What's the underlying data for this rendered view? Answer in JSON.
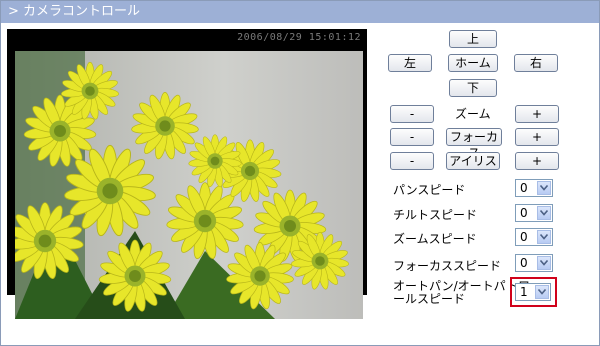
{
  "header": {
    "title": "> カメラコントロール"
  },
  "camera": {
    "timestamp": "2006/08/29 15:01:12"
  },
  "controls": {
    "up": "上",
    "left": "左",
    "home": "ホーム",
    "right": "右",
    "down": "下",
    "zoom_minus": "-",
    "zoom_label": "ズーム",
    "zoom_plus": "+",
    "focus_minus": "-",
    "focus": "フォーカス",
    "focus_plus": "+",
    "iris_minus": "-",
    "iris": "アイリス",
    "iris_plus": "+"
  },
  "speeds": [
    {
      "label": "パンスピード",
      "value": "0"
    },
    {
      "label": "チルトスピード",
      "value": "0"
    },
    {
      "label": "ズームスピード",
      "value": "0"
    },
    {
      "label": "フォーカススピード",
      "value": "0"
    },
    {
      "label_line1": "オートパン/オートパトロ",
      "label_line2": "ールスピード",
      "value": "1"
    }
  ],
  "colors": {
    "title_bar": "#9db0d6",
    "highlight": "#d0021b"
  }
}
